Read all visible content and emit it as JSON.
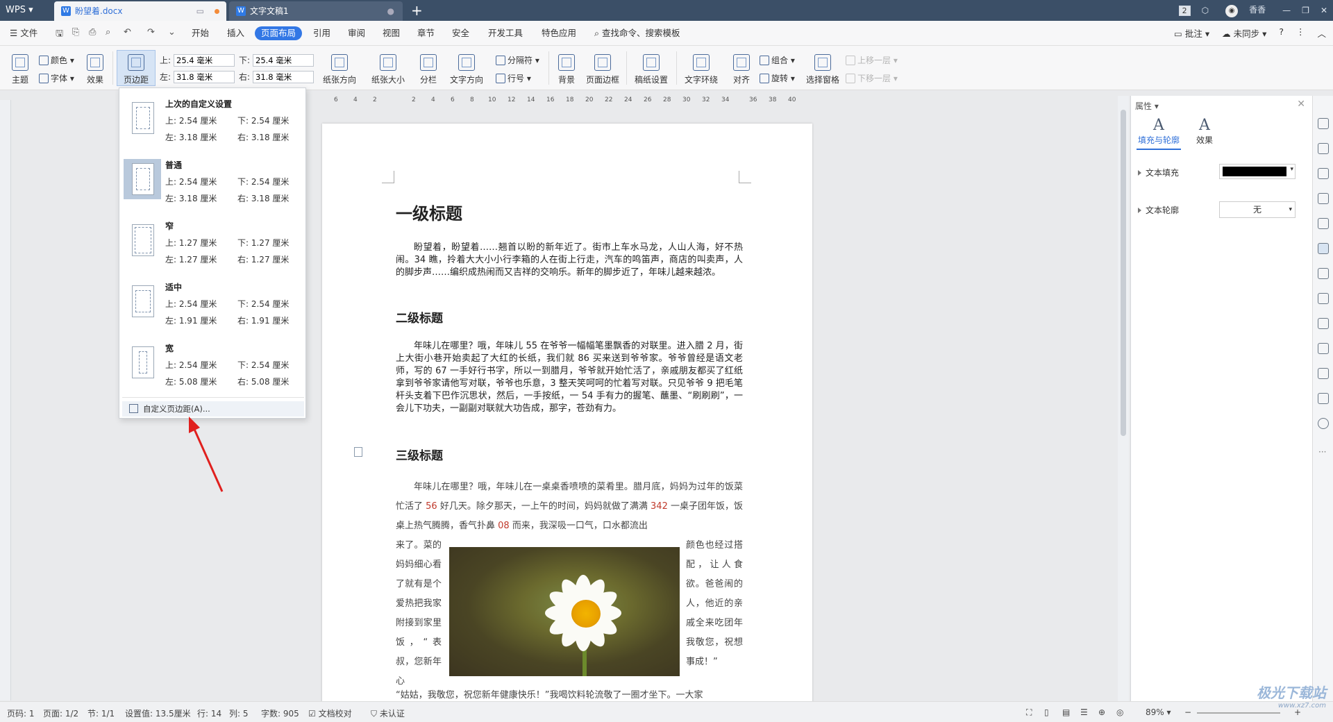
{
  "titlebar": {
    "app": "WPS",
    "tabs": [
      {
        "label": "盼望着.docx"
      },
      {
        "label": "文字文稿1"
      }
    ],
    "badge": "2",
    "user": "香香"
  },
  "menu": {
    "file": "文件",
    "items": [
      "开始",
      "插入",
      "页面布局",
      "引用",
      "审阅",
      "视图",
      "章节",
      "安全",
      "开发工具",
      "特色应用"
    ],
    "active": "页面布局",
    "search": "查找命令、搜索模板",
    "right": [
      "批注",
      "未同步"
    ]
  },
  "ribbon": {
    "theme": "主题",
    "colors": "颜色",
    "fonts": "字体",
    "effects": "效果",
    "margins": "页边距",
    "top_label": "上:",
    "top_value": "25.4 毫米",
    "bottom_label": "下:",
    "bottom_value": "25.4 毫米",
    "left_label": "左:",
    "left_value": "31.8 毫米",
    "right_label": "右:",
    "right_value": "31.8 毫米",
    "orientation": "纸张方向",
    "size": "纸张大小",
    "columns": "分栏",
    "text_direction": "文字方向",
    "breaks": "分隔符",
    "line_numbers": "行号",
    "background": "背景",
    "page_border": "页面边框",
    "manuscript": "稿纸设置",
    "wrap": "文字环绕",
    "align": "对齐",
    "group": "组合",
    "rotate": "旋转",
    "selection_pane": "选择窗格",
    "bring_forward": "上移一层",
    "send_backward": "下移一层"
  },
  "ruler": {
    "ticks": [
      "6",
      "4",
      "2",
      "2",
      "4",
      "6",
      "8",
      "10",
      "12",
      "14",
      "16",
      "18",
      "20",
      "22",
      "24",
      "26",
      "28",
      "30",
      "32",
      "34",
      "36",
      "38",
      "40"
    ]
  },
  "margins_dropdown": {
    "items": [
      {
        "name": "上次的自定义设置",
        "top": "上: 2.54 厘米",
        "bottom": "下: 2.54 厘米",
        "left": "左: 3.18 厘米",
        "right": "右: 3.18 厘米"
      },
      {
        "name": "普通",
        "top": "上: 2.54 厘米",
        "bottom": "下: 2.54 厘米",
        "left": "左: 3.18 厘米",
        "right": "右: 3.18 厘米"
      },
      {
        "name": "窄",
        "top": "上: 1.27 厘米",
        "bottom": "下: 1.27 厘米",
        "left": "左: 1.27 厘米",
        "right": "右: 1.27 厘米"
      },
      {
        "name": "适中",
        "top": "上: 2.54 厘米",
        "bottom": "下: 2.54 厘米",
        "left": "左: 1.91 厘米",
        "right": "右: 1.91 厘米"
      },
      {
        "name": "宽",
        "top": "上: 2.54 厘米",
        "bottom": "下: 2.54 厘米",
        "left": "左: 5.08 厘米",
        "right": "右: 5.08 厘米"
      }
    ],
    "custom": "自定义页边距(A)..."
  },
  "document": {
    "h1": "一级标题",
    "p1": "盼望着，盼望着……翘首以盼的新年近了。街市上车水马龙，人山人海，好不热闹。34 瞧，拎着大大小小行李箱的人在街上行走，汽车的鸣笛声，商店的叫卖声，人的脚步声……编织成热闹而又吉祥的交响乐。新年的脚步近了，年味儿越来越浓。",
    "h2": "二级标题",
    "p2": "年味儿在哪里？哦，年味儿 55 在爷爷一幅幅笔墨飘香的对联里。进入腊 2 月，街上大街小巷开始卖起了大红的长纸，我们就 86 买来送到爷爷家。爷爷曾经是语文老师，写的 67 一手好行书字，所以一到腊月，爷爷就开始忙活了，亲戚朋友都买了红纸拿到爷爷家请他写对联，爷爷也乐意，3 整天笑呵呵的忙着写对联。只见爷爷 9 把毛笔杆头支着下巴作沉思状，然后，一手按纸，一 54 手有力的握笔、蘸墨、“刷刷刷”，一会儿下功夫，一副副对联就大功告成，那字，苍劲有力。",
    "h3": "三级标题",
    "p3_a": "年味儿在哪里？哦，年味儿在一桌桌香喷喷的菜肴里。腊月底，妈妈为过年的饭菜忙活了 ",
    "p3_n1": "56",
    "p3_b": " 好几天。除夕那天，一上午的时间，妈妈就做了满满 ",
    "p3_n2": "342",
    "p3_c": " 一桌子团年饭，饭桌上热气腾腾，香气扑鼻 ",
    "p3_n3": "08",
    "p3_d": " 而来，我深吸一口气，口水都流出",
    "left_col": "来了。菜的妈妈细心看了就有是个爱热把我家附接到家里饭，“表叔，您新年心",
    "right_col": "颜色也经过搭配，让人食欲。爸爸闹的人，他近的亲戚全来吃团年我敬您，祝想事成！”",
    "last_line": "“姑姑，我敬您，祝您新年健康快乐！”我喝饮料轮流敬了一圈才坐下。一大家"
  },
  "right_panel": {
    "title": "属性",
    "tab_fill": "填充与轮廓",
    "tab_effect": "效果",
    "glyph": "A",
    "text_fill": "文本填充",
    "text_outline": "文本轮廓",
    "outline_value": "无",
    "fill_color": "#000000"
  },
  "status": {
    "page_num": "页码: 1",
    "page": "页面: 1/2",
    "section": "节: 1/1",
    "setting": "设置值: 13.5厘米",
    "row": "行: 14",
    "col": "列: 5",
    "words": "字数: 905",
    "proof": "文档校对",
    "cert": "未认证",
    "zoom": "89%"
  },
  "watermark": {
    "text": "极光下载站",
    "url": "www.xz7.com"
  },
  "colors": {
    "accent": "#3277e5",
    "titlebar": "#3b4f67",
    "arrow": "#e0201e"
  }
}
